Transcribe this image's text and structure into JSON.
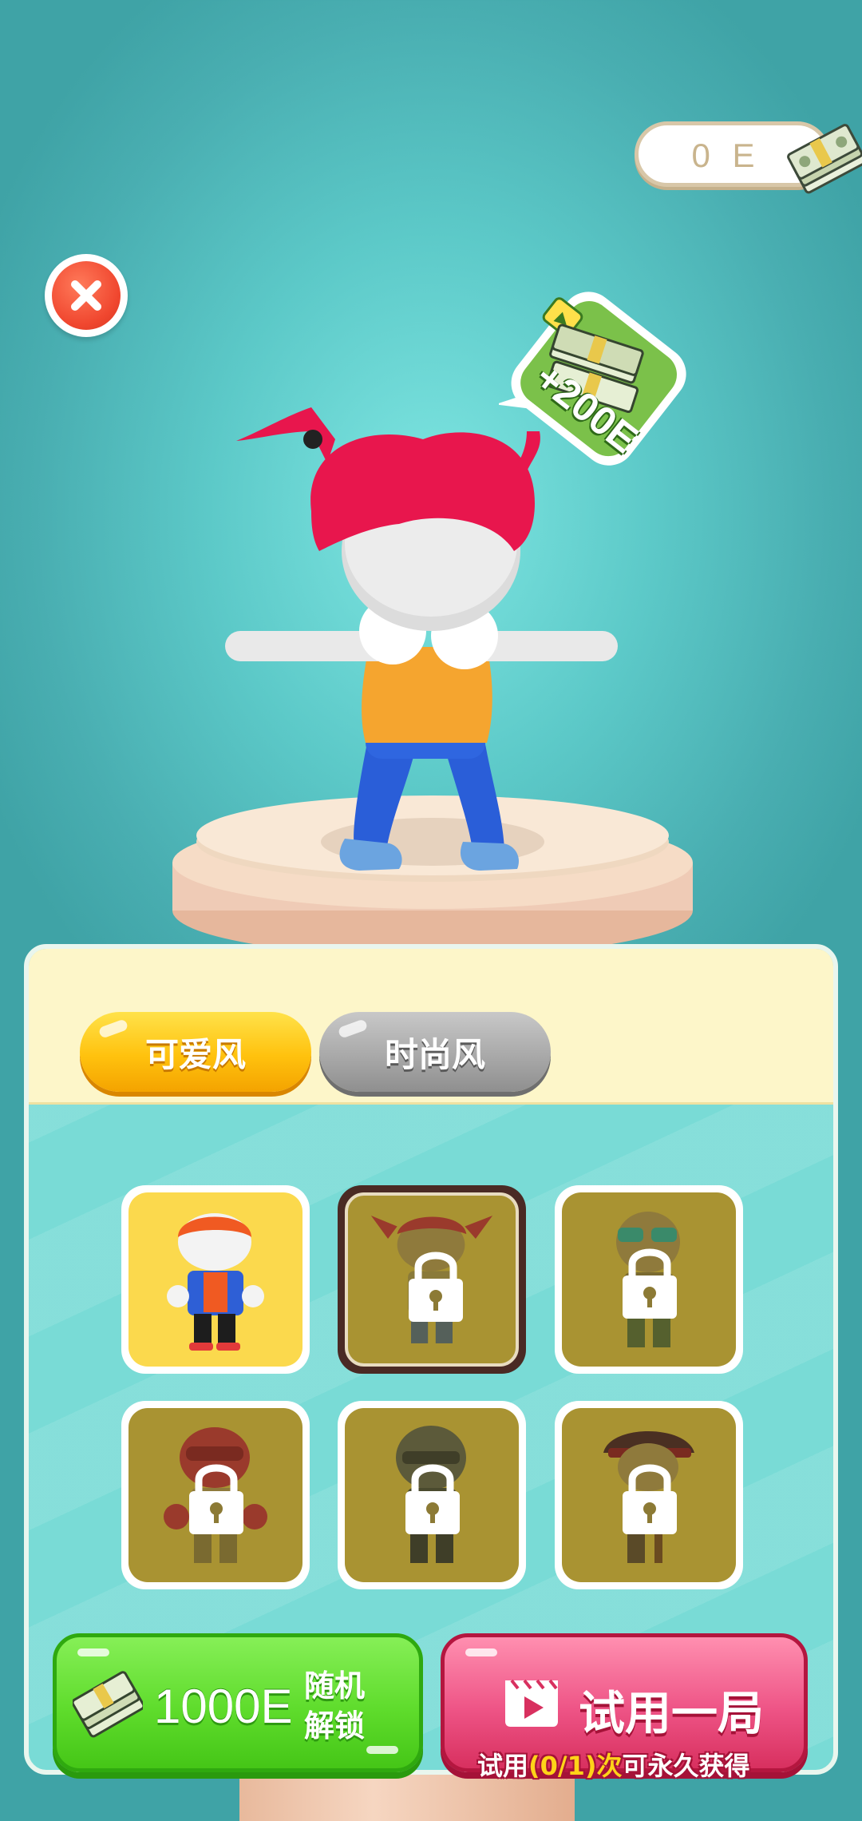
{
  "currency": {
    "value": "0 E",
    "icon": "cash-stack-icon"
  },
  "close_button": {
    "icon": "close-icon",
    "color": "#f0472f"
  },
  "reward_badge": {
    "label": "+200E",
    "icon": "video-ad-icon"
  },
  "tabs": [
    {
      "label": "可爱风",
      "selected": true,
      "color": "#ffc20e"
    },
    {
      "label": "时尚风",
      "selected": false,
      "color": "#a9a9a9"
    }
  ],
  "skins": [
    {
      "name": "cap-boy",
      "locked": false,
      "selected": false
    },
    {
      "name": "pigtail-girl",
      "locked": true,
      "selected": true
    },
    {
      "name": "sunglasses-man",
      "locked": true,
      "selected": false
    },
    {
      "name": "boxer",
      "locked": true,
      "selected": false
    },
    {
      "name": "helmet-soldier",
      "locked": true,
      "selected": false
    },
    {
      "name": "pirate",
      "locked": true,
      "selected": false
    }
  ],
  "random_unlock": {
    "price": "1000E",
    "label_line1": "随机",
    "label_line2": "解锁"
  },
  "trial": {
    "label": "试用一局",
    "note_prefix": "试用",
    "note_count": "(0/1)",
    "note_mid": "次",
    "note_suffix": "可永久获得"
  }
}
